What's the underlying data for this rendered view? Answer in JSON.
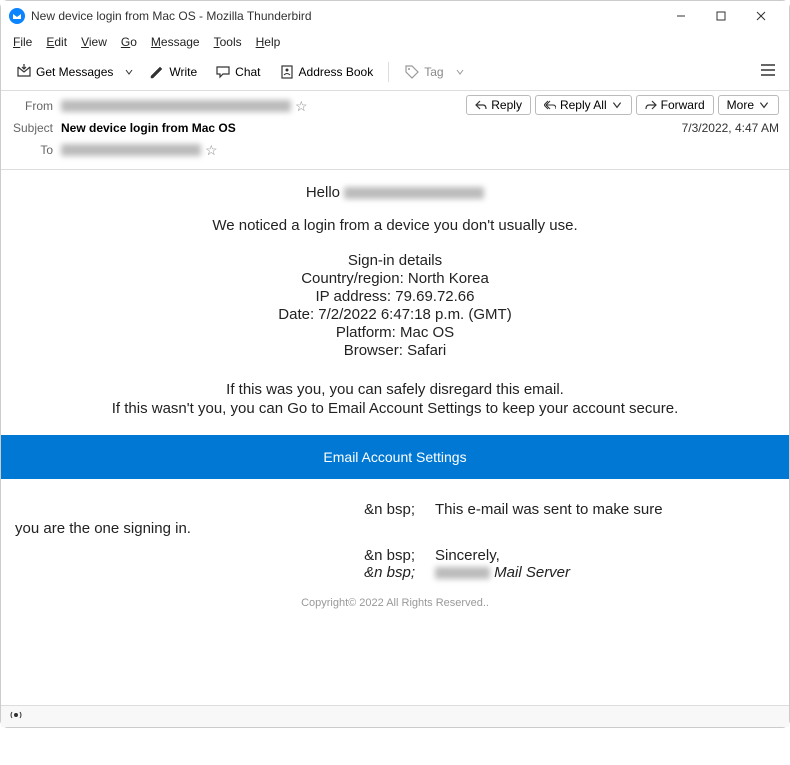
{
  "window": {
    "title": "New device login from Mac OS - Mozilla Thunderbird"
  },
  "menubar": {
    "file": "File",
    "edit": "Edit",
    "view": "View",
    "go": "Go",
    "message": "Message",
    "tools": "Tools",
    "help": "Help"
  },
  "toolbar": {
    "get_messages": "Get Messages",
    "write": "Write",
    "chat": "Chat",
    "address_book": "Address Book",
    "tag": "Tag"
  },
  "headers": {
    "from_label": "From",
    "subject_label": "Subject",
    "to_label": "To",
    "subject_value": "New device login from Mac OS",
    "date": "7/3/2022, 4:47 AM",
    "reply": "Reply",
    "reply_all": "Reply All",
    "forward": "Forward",
    "more": "More"
  },
  "email": {
    "hello": "Hello",
    "notice": "We noticed a login from a device you don't usually use.",
    "details_title": "Sign-in details",
    "country": "Country/region: North Korea",
    "ip": "IP address: 79.69.72.66",
    "date": "Date: 7/2/2022 6:47:18 p.m. (GMT)",
    "platform": "Platform: Mac OS",
    "browser": "Browser: Safari",
    "safe": "If this was you, you can safely disregard this email.",
    "not_safe": "If this wasn't you, you can Go to Email Account Settings to keep your account secure.",
    "cta": "Email Account Settings",
    "nbsp": "&n bsp;",
    "footer1": "This e-mail was sent to make sure",
    "footer1b": "you are the one signing in.",
    "sincerely": "Sincerely,",
    "mailserver": " Mail Server",
    "copyright": "Copyright© 2022 All Rights Reserved.."
  }
}
